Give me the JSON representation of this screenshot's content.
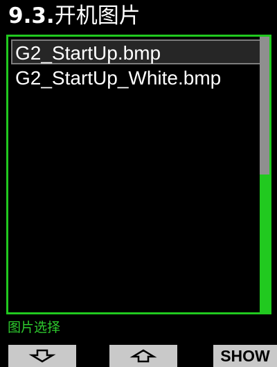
{
  "header": {
    "title_num": "9.3.",
    "title_text": "开机图片"
  },
  "file_list": {
    "items": [
      {
        "label": "G2_StartUp.bmp",
        "selected": true
      },
      {
        "label": "G2_StartUp_White.bmp",
        "selected": false
      }
    ],
    "scroll_position_fraction": 0.5
  },
  "status": {
    "text": "图片选择"
  },
  "footer": {
    "down_icon": "arrow-down-icon",
    "up_icon": "arrow-up-icon",
    "show_label": "SHOW"
  },
  "colors": {
    "accent_green": "#21c91f",
    "selection_border": "#7d7d7d",
    "button_bg": "#c9c9c9"
  }
}
